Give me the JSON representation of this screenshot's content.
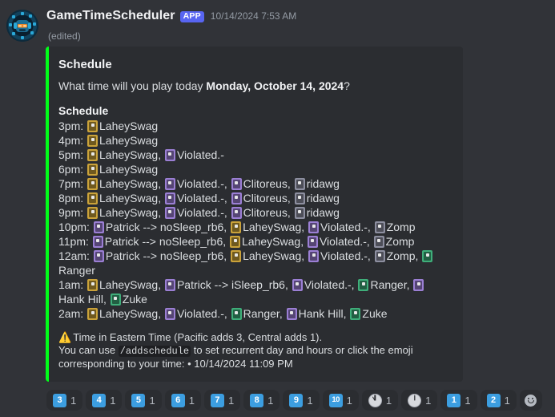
{
  "message": {
    "author": "GameTimeScheduler",
    "app_badge": "APP",
    "timestamp": "10/14/2024 7:53 AM",
    "edited_label": "(edited)",
    "avatar_icon": "robot-gamer-avatar"
  },
  "embed": {
    "accent_color": "#00ff19",
    "title": "Schedule",
    "description_prefix": "What time will you play today ",
    "description_bold": "Monday, October 14, 2024",
    "description_suffix": "?",
    "field_name": "Schedule",
    "rows": [
      {
        "time": "3pm:",
        "entries": [
          {
            "emoji": "gold",
            "name": "LaheySwag"
          }
        ]
      },
      {
        "time": "4pm:",
        "entries": [
          {
            "emoji": "gold",
            "name": "LaheySwag"
          }
        ]
      },
      {
        "time": "5pm:",
        "entries": [
          {
            "emoji": "gold",
            "name": "LaheySwag"
          },
          {
            "emoji": "purple",
            "name": "Violated.-"
          }
        ]
      },
      {
        "time": "6pm:",
        "entries": [
          {
            "emoji": "gold",
            "name": "LaheySwag"
          }
        ]
      },
      {
        "time": "7pm:",
        "entries": [
          {
            "emoji": "gold",
            "name": "LaheySwag"
          },
          {
            "emoji": "purple",
            "name": "Violated.-"
          },
          {
            "emoji": "purple",
            "name": "Clitoreus"
          },
          {
            "emoji": "grey",
            "name": "ridawg"
          }
        ]
      },
      {
        "time": "8pm:",
        "entries": [
          {
            "emoji": "gold",
            "name": "LaheySwag"
          },
          {
            "emoji": "purple",
            "name": "Violated.-"
          },
          {
            "emoji": "purple",
            "name": "Clitoreus"
          },
          {
            "emoji": "grey",
            "name": "ridawg"
          }
        ]
      },
      {
        "time": "9pm:",
        "entries": [
          {
            "emoji": "gold",
            "name": "LaheySwag"
          },
          {
            "emoji": "purple",
            "name": "Violated.-"
          },
          {
            "emoji": "purple",
            "name": "Clitoreus"
          },
          {
            "emoji": "grey",
            "name": "ridawg"
          }
        ]
      },
      {
        "time": "10pm:",
        "entries": [
          {
            "emoji": "purple",
            "name": "Patrick --> noSleep_rb6"
          },
          {
            "emoji": "gold",
            "name": "LaheySwag"
          },
          {
            "emoji": "purple",
            "name": "Violated.-"
          },
          {
            "emoji": "grey",
            "name": "Zomp"
          }
        ]
      },
      {
        "time": "11pm:",
        "entries": [
          {
            "emoji": "purple",
            "name": "Patrick --> noSleep_rb6"
          },
          {
            "emoji": "gold",
            "name": "LaheySwag"
          },
          {
            "emoji": "purple",
            "name": "Violated.-"
          },
          {
            "emoji": "grey",
            "name": "Zomp"
          }
        ]
      },
      {
        "time": "12am:",
        "entries": [
          {
            "emoji": "purple",
            "name": "Patrick --> noSleep_rb6"
          },
          {
            "emoji": "gold",
            "name": "LaheySwag"
          },
          {
            "emoji": "purple",
            "name": "Violated.-"
          },
          {
            "emoji": "grey",
            "name": "Zomp"
          },
          {
            "emoji": "green",
            "name": "Ranger"
          }
        ]
      },
      {
        "time": "1am:",
        "entries": [
          {
            "emoji": "gold",
            "name": "LaheySwag"
          },
          {
            "emoji": "purple",
            "name": "Patrick --> iSleep_rb6"
          },
          {
            "emoji": "purple",
            "name": "Violated.-"
          },
          {
            "emoji": "green",
            "name": "Ranger"
          },
          {
            "emoji": "purple",
            "name": "Hank Hill"
          },
          {
            "emoji": "green",
            "name": "Zuke"
          }
        ]
      },
      {
        "time": "2am:",
        "entries": [
          {
            "emoji": "gold",
            "name": "LaheySwag"
          },
          {
            "emoji": "purple",
            "name": "Violated.-"
          },
          {
            "emoji": "green",
            "name": "Ranger"
          },
          {
            "emoji": "purple",
            "name": "Hank Hill"
          },
          {
            "emoji": "green",
            "name": "Zuke"
          }
        ]
      }
    ],
    "footer": {
      "warning_icon": "warning-triangle-icon",
      "warning_text": "Time in Eastern Time (Pacific adds 3, Central adds 1).",
      "hint_prefix": "You can use ",
      "hint_code": "/addschedule",
      "hint_suffix": " to set recurrent day and hours or click the emoji corresponding to your time: • 10/14/2024 11:09 PM"
    }
  },
  "reactions": [
    {
      "emoji": "keycap-3",
      "type": "keycap",
      "label": "3",
      "count": "1"
    },
    {
      "emoji": "keycap-4",
      "type": "keycap",
      "label": "4",
      "count": "1"
    },
    {
      "emoji": "keycap-5",
      "type": "keycap",
      "label": "5",
      "count": "1"
    },
    {
      "emoji": "keycap-6",
      "type": "keycap",
      "label": "6",
      "count": "1"
    },
    {
      "emoji": "keycap-7",
      "type": "keycap",
      "label": "7",
      "count": "1"
    },
    {
      "emoji": "keycap-8",
      "type": "keycap",
      "label": "8",
      "count": "1"
    },
    {
      "emoji": "keycap-9",
      "type": "keycap",
      "label": "9",
      "count": "1"
    },
    {
      "emoji": "keycap-10",
      "type": "keycap",
      "label": "10",
      "count": "1"
    },
    {
      "emoji": "clock-eleven-oclock",
      "type": "clock",
      "hour": 11,
      "count": "1"
    },
    {
      "emoji": "clock-twelve-oclock",
      "type": "clock",
      "hour": 12,
      "count": "1"
    },
    {
      "emoji": "keycap-1",
      "type": "keycap",
      "label": "1",
      "count": "1"
    },
    {
      "emoji": "keycap-2",
      "type": "keycap",
      "label": "2",
      "count": "1"
    }
  ],
  "add_reaction": {
    "icon": "add-reaction-smiley-icon"
  },
  "colors": {
    "embed_accent": "#00ff19",
    "app_badge": "#5865f2",
    "keycap_blue": "#3c9ee0",
    "embed_bg": "#2b2d31",
    "page_bg": "#313338"
  }
}
